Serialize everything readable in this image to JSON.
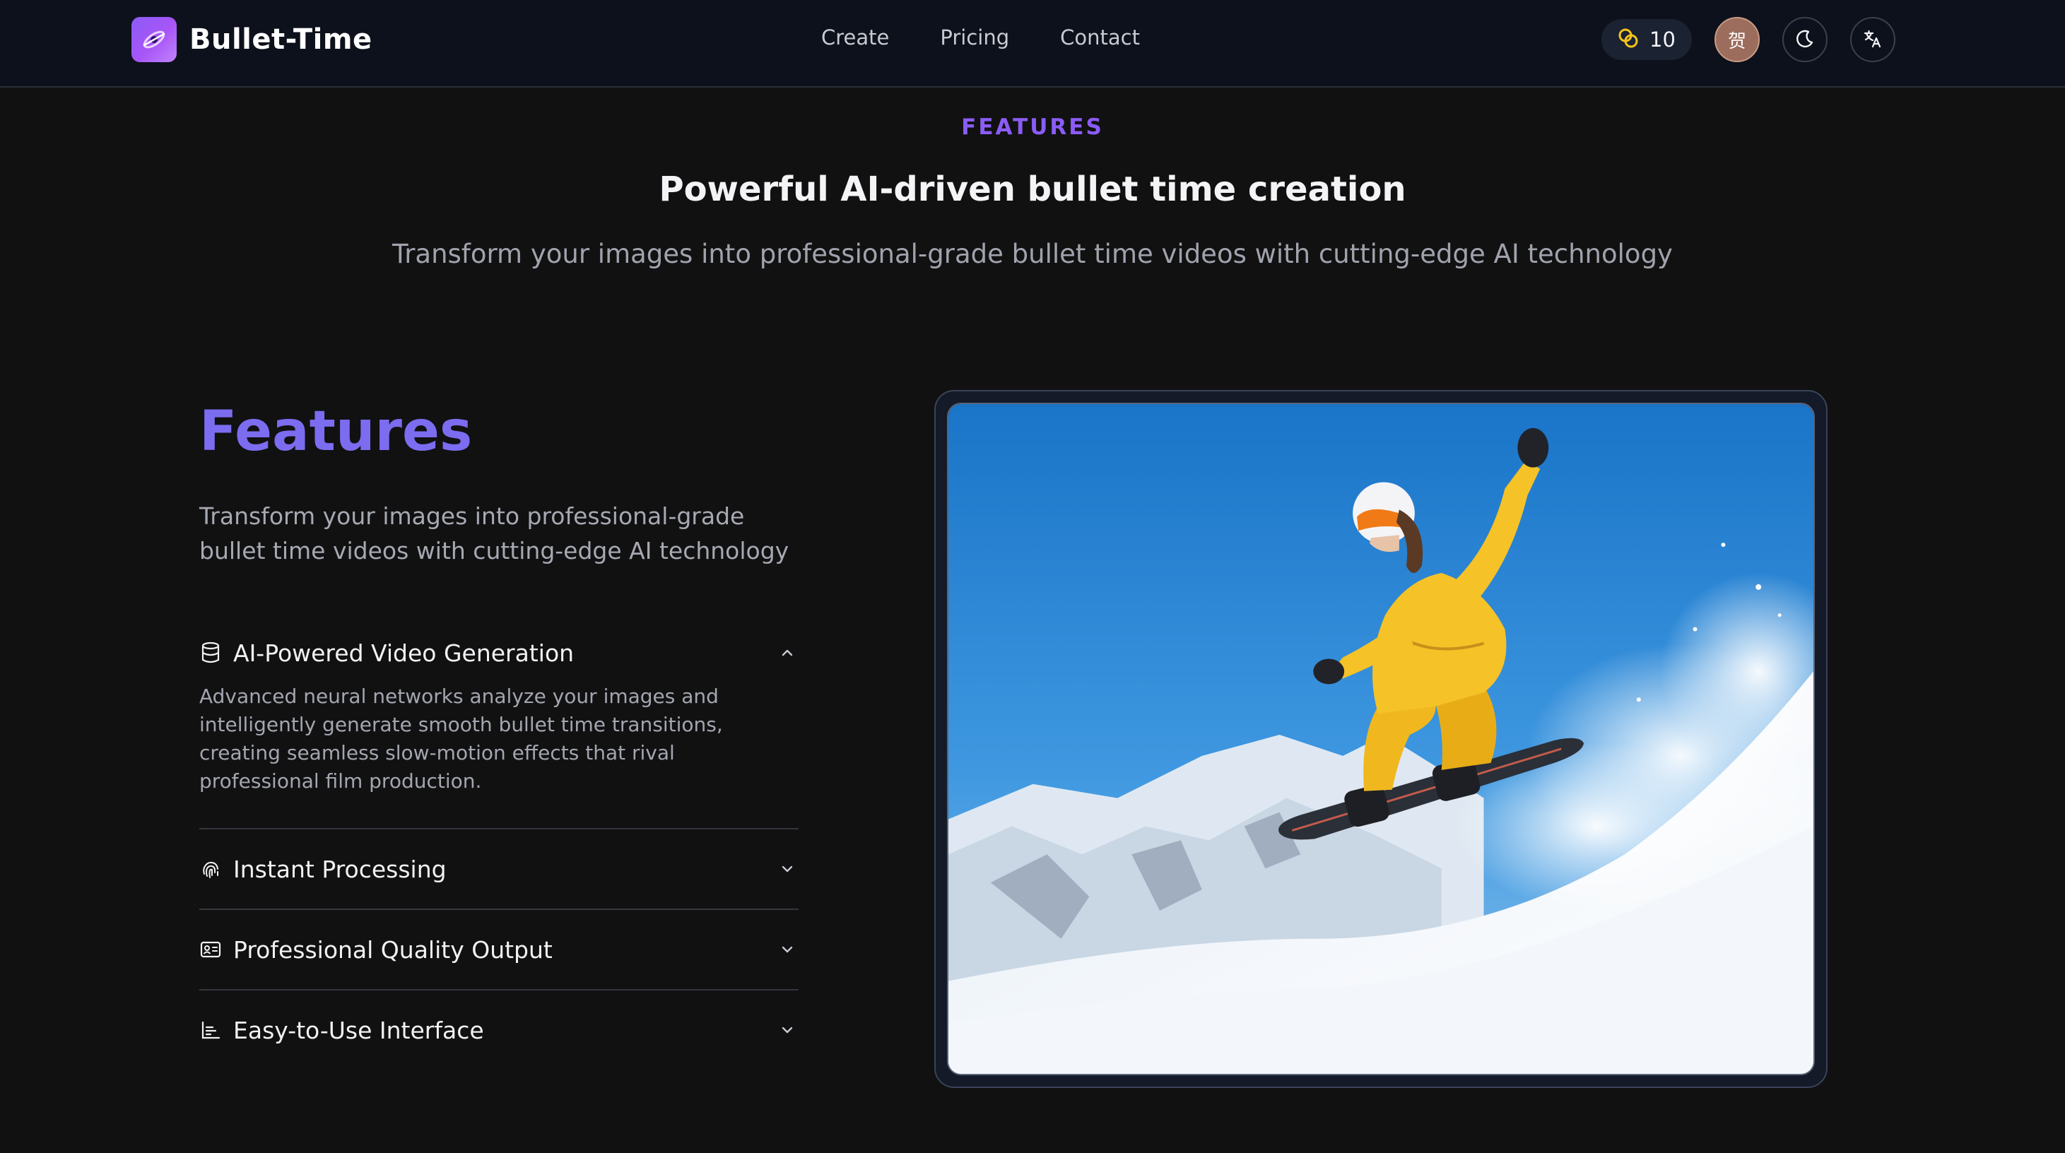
{
  "nav": {
    "brand": "Bullet-Time",
    "links": [
      "Create",
      "Pricing",
      "Contact"
    ],
    "credits": "10",
    "avatar_glyph": "贺"
  },
  "header": {
    "eyebrow": "FEATURES",
    "title": "Powerful AI-driven bullet time creation",
    "subtitle": "Transform your images into professional-grade bullet time videos with cutting-edge AI technology"
  },
  "features": {
    "title": "Features",
    "description": "Transform your images into professional-grade bullet time videos with cutting-edge AI technology",
    "items": [
      {
        "icon": "database-icon",
        "title": "AI-Powered Video Generation",
        "expanded": true,
        "body": "Advanced neural networks analyze your images and intelligently generate smooth bullet time transitions, creating seamless slow-motion effects that rival professional film production."
      },
      {
        "icon": "fingerprint-icon",
        "title": "Instant Processing",
        "expanded": false
      },
      {
        "icon": "id-card-icon",
        "title": "Professional Quality Output",
        "expanded": false
      },
      {
        "icon": "bar-chart-icon",
        "title": "Easy-to-Use Interface",
        "expanded": false
      }
    ]
  },
  "colors": {
    "accent": "#8b5cf6",
    "features_title": "#7c6cf0",
    "nav_bg": "#0d111b",
    "page_bg": "#111112"
  }
}
